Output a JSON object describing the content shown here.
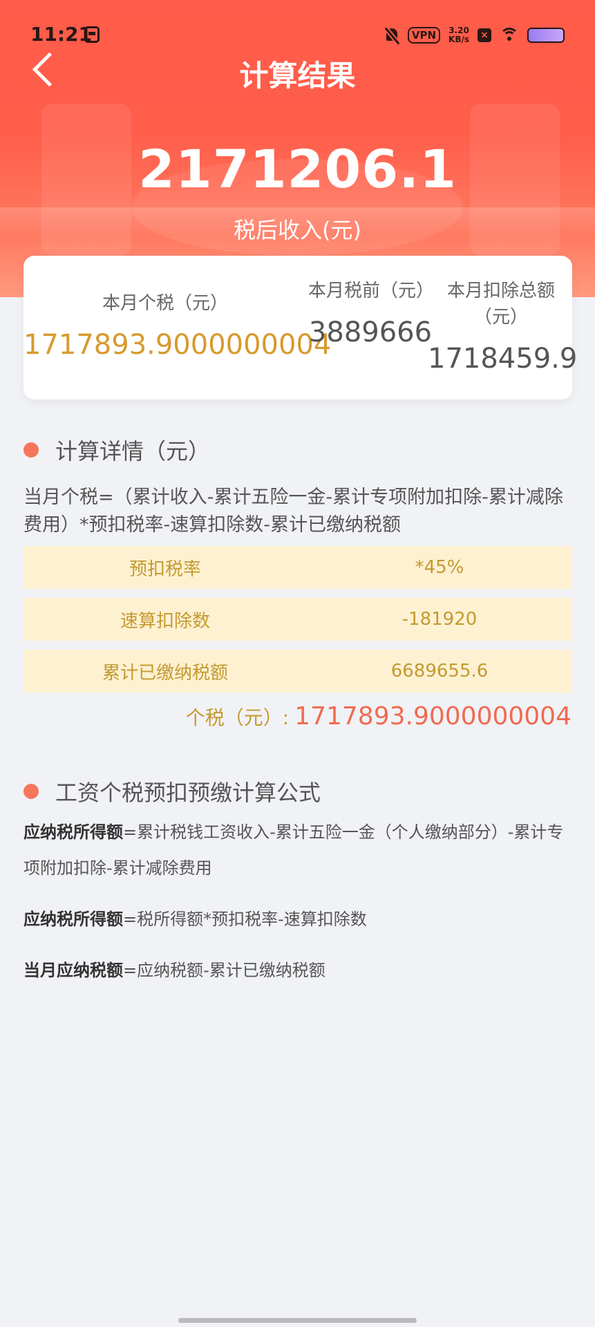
{
  "status_bar": {
    "time": "11:21",
    "vpn_label": "VPN",
    "net_speed_value": "3.20",
    "net_speed_unit": "KB/s"
  },
  "nav": {
    "title": "计算结果"
  },
  "hero": {
    "net_income": "2171206.1",
    "net_income_label": "税后收入(元)"
  },
  "summary": {
    "tax_label": "本月个税（元）",
    "tax_value": "1717893.9000000004",
    "pretax_label": "本月税前（元）",
    "pretax_value": "3889666",
    "deduction_label": "本月扣除总额（元）",
    "deduction_value": "1718459.9"
  },
  "details": {
    "section_title": "计算详情（元）",
    "formula": "当月个税=（累计收入-累计五险一金-累计专项附加扣除-累计减除费用）*预扣税率-速算扣除数-累计已缴纳税额",
    "rows": [
      {
        "label": "预扣税率",
        "value": "*45%"
      },
      {
        "label": "速算扣除数",
        "value": "-181920"
      },
      {
        "label": "累计已缴纳税额",
        "value": "6689655.6"
      }
    ],
    "total_label": "个税（元）:",
    "total_value": "1717893.9000000004"
  },
  "rules": {
    "section_title": "工资个税预扣预缴计算公式",
    "items": [
      {
        "term": "应纳税所得额",
        "desc": "=累计税钱工资收入-累计五险一金（个人缴纳部分）-累计专项附加扣除-累计减除费用"
      },
      {
        "term": "应纳税所得额",
        "desc": "=税所得额*预扣税率-速算扣除数"
      },
      {
        "term": "当月应纳税额",
        "desc": "=应纳税额-累计已缴纳税额"
      }
    ]
  },
  "colors": {
    "accent": "#ff5b4a",
    "gold": "#c49a30",
    "tax_value": "#d79a2d",
    "highlight": "#f06b4f",
    "row_bg": "#fdf1d1"
  }
}
